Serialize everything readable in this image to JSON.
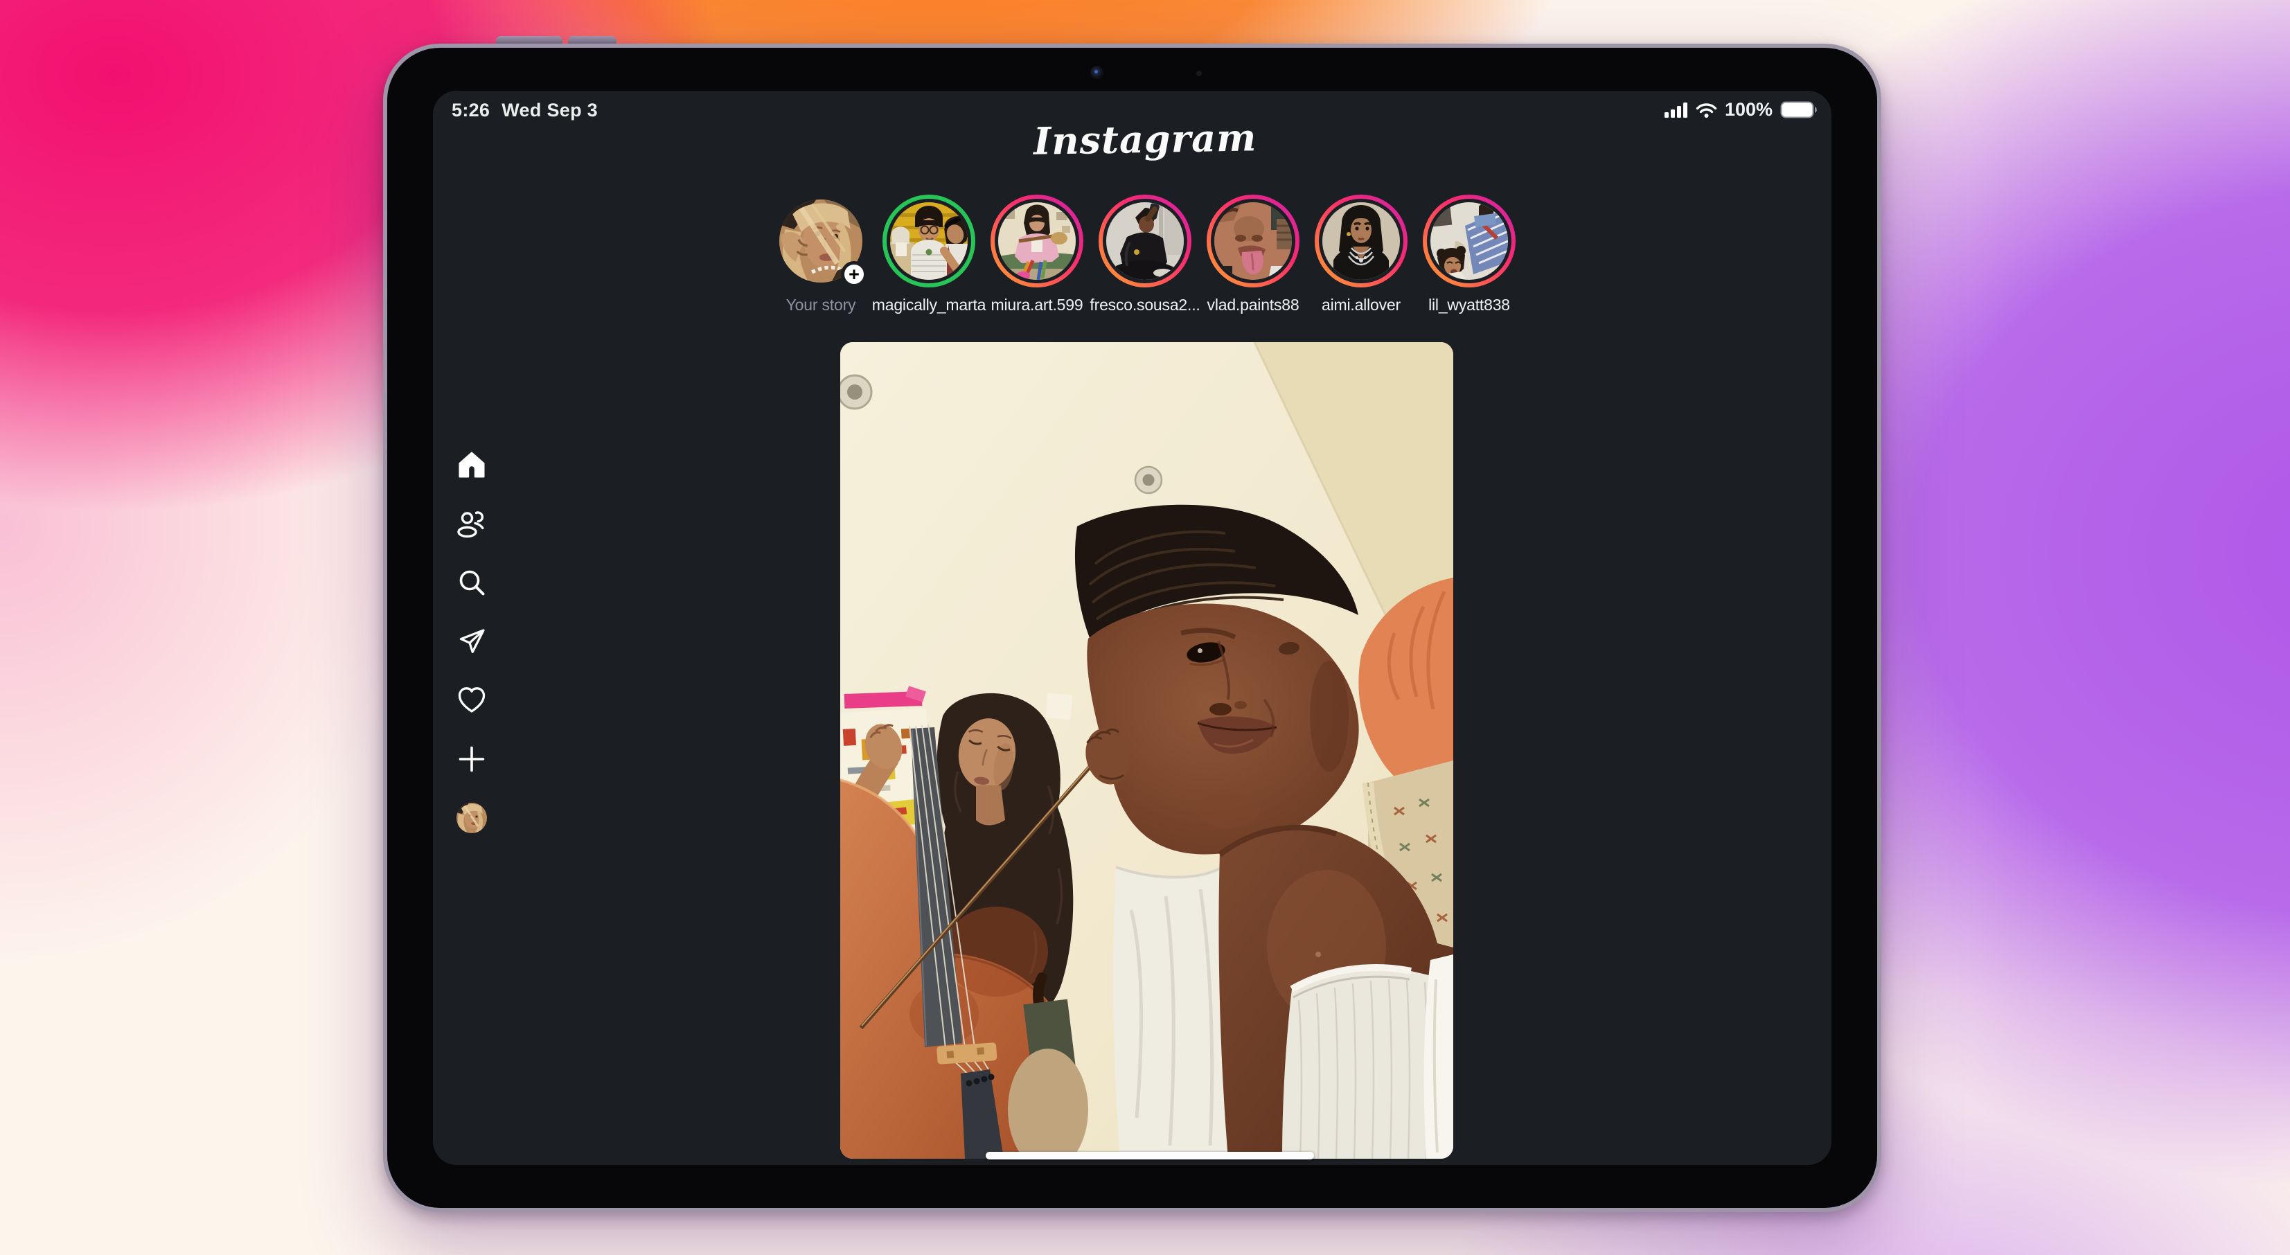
{
  "wallpaper": {
    "colors": {
      "pink": "#f2106f",
      "orange": "#fb7e22",
      "purple": "#ae57e9",
      "base": "#fdf4ec"
    }
  },
  "status_bar": {
    "time": "5:26",
    "date": "Wed Sep 3",
    "battery_level": "100%",
    "icons": [
      "cellular-signal-icon",
      "wifi-icon",
      "battery-icon"
    ]
  },
  "header": {
    "logo_text": "Instagram"
  },
  "stories": {
    "items": [
      {
        "username": "Your story",
        "ring": "none",
        "add_button": "+"
      },
      {
        "username": "magically_marta",
        "ring": "green"
      },
      {
        "username": "miura.art.599",
        "ring": "gradient"
      },
      {
        "username": "fresco.sousa2...",
        "ring": "gradient"
      },
      {
        "username": "vlad.paints88",
        "ring": "gradient"
      },
      {
        "username": "aimi.allover",
        "ring": "gradient"
      },
      {
        "username": "lil_wyatt838",
        "ring": "gradient"
      }
    ]
  },
  "sidebar": {
    "items": [
      {
        "name": "home",
        "icon": "home-icon",
        "active": true
      },
      {
        "name": "following",
        "icon": "people-icon"
      },
      {
        "name": "search",
        "icon": "search-icon"
      },
      {
        "name": "messages",
        "icon": "send-icon"
      },
      {
        "name": "notifications",
        "icon": "heart-icon"
      },
      {
        "name": "create",
        "icon": "plus-icon"
      },
      {
        "name": "profile",
        "icon": "profile-avatar"
      }
    ]
  },
  "colors": {
    "app_background": "#1b1e23",
    "story_ring_green": "#27c457",
    "story_ring_gradient": [
      "#ff9d33",
      "#f72b6e",
      "#cf22ab"
    ],
    "story_label": "#f1f2f3",
    "your_story_label": "#8f939a",
    "home_indicator": "#fcfcfc"
  }
}
